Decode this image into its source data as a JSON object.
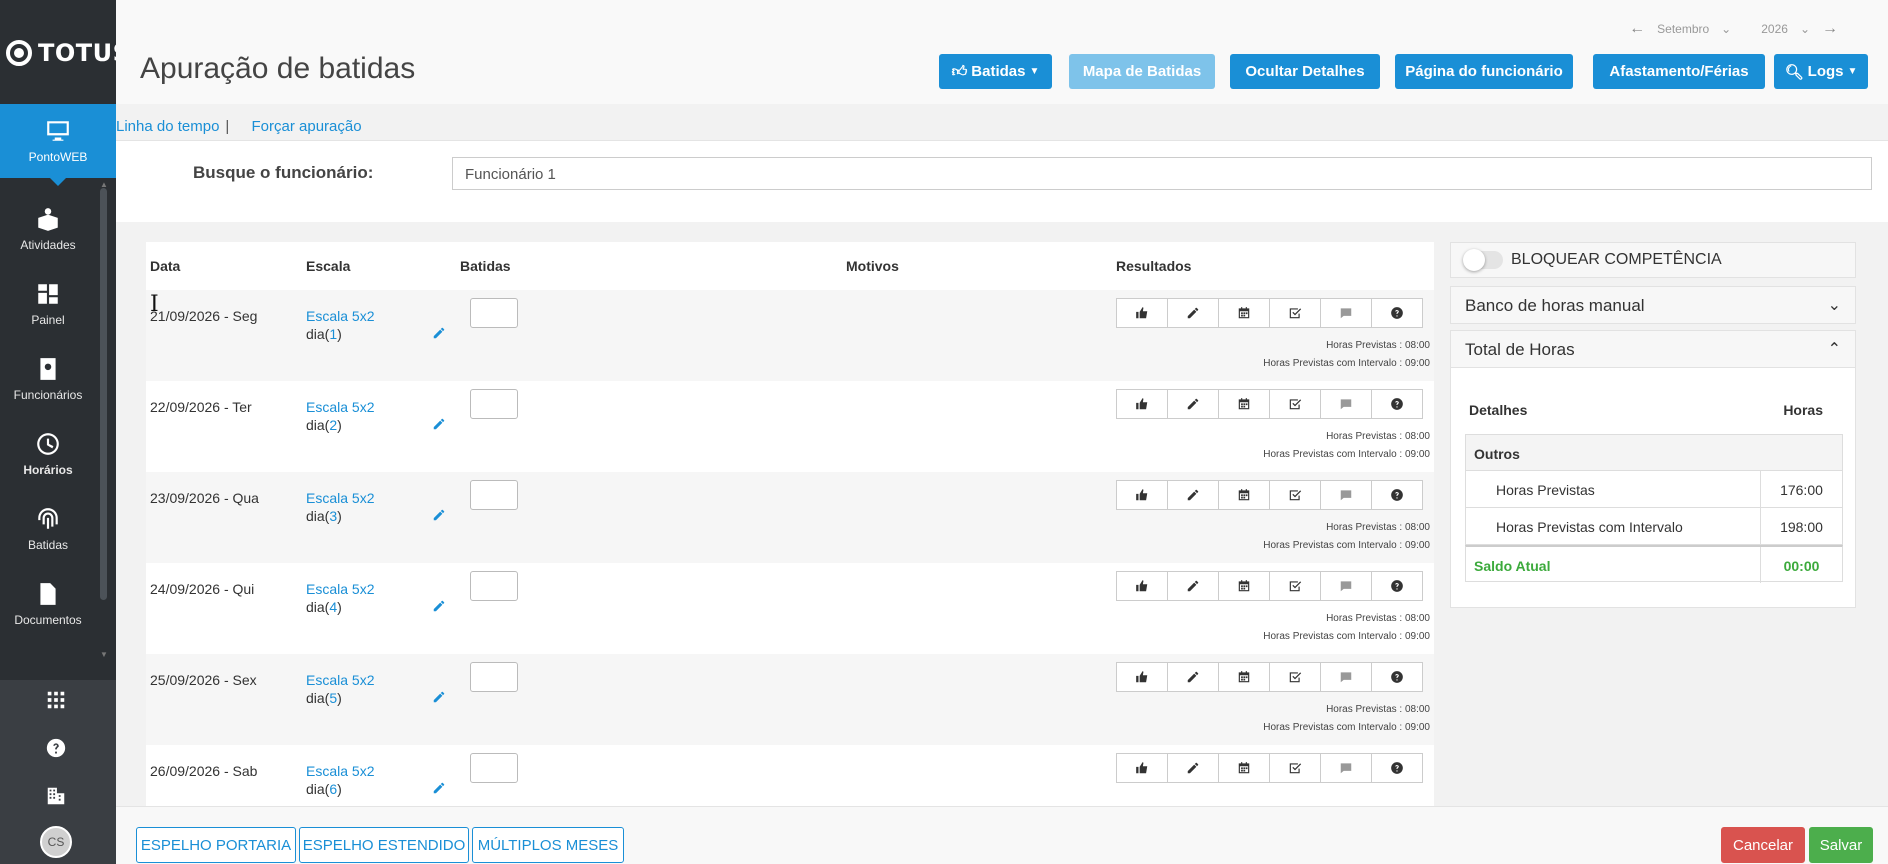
{
  "sidebar": {
    "brand": "TOTUS",
    "items": [
      {
        "label": "PontoWEB",
        "icon": "monitor-icon"
      },
      {
        "label": "Atividades",
        "icon": "activities-icon"
      },
      {
        "label": "Painel",
        "icon": "dashboard-icon"
      },
      {
        "label": "Funcionários",
        "icon": "badge-icon"
      },
      {
        "label": "Horários",
        "icon": "clock-icon"
      },
      {
        "label": "Batidas",
        "icon": "fingerprint-icon"
      },
      {
        "label": "Documentos",
        "icon": "document-icon"
      }
    ],
    "avatar": "CS"
  },
  "header": {
    "title": "Apuração de batidas",
    "month": "Setembro",
    "year": "2026",
    "buttons": {
      "batidas": "Batidas",
      "mapa": "Mapa de Batidas",
      "ocultar": "Ocultar Detalhes",
      "pagina": "Página do funcionário",
      "afastamento": "Afastamento/Férias",
      "logs": "Logs"
    }
  },
  "subnav": {
    "timeline": "Linha do tempo",
    "forcar": "Forçar apuração"
  },
  "search": {
    "label": "Busque o funcionário:",
    "value": "Funcionário 1"
  },
  "grid": {
    "headers": {
      "data": "Data",
      "escala": "Escala",
      "batidas": "Batidas",
      "motivos": "Motivos",
      "resultados": "Resultados"
    },
    "rows": [
      {
        "date": "21/09/2026 - Seg",
        "escala": "Escala 5x2",
        "dia_prefix": "dia(",
        "dia_num": "1",
        "dia_suffix": ")",
        "hp": "Horas Previstas : 08:00",
        "hpi": "Horas Previstas com Intervalo : 09:00"
      },
      {
        "date": "22/09/2026 - Ter",
        "escala": "Escala 5x2",
        "dia_prefix": "dia(",
        "dia_num": "2",
        "dia_suffix": ")",
        "hp": "Horas Previstas : 08:00",
        "hpi": "Horas Previstas com Intervalo : 09:00"
      },
      {
        "date": "23/09/2026 - Qua",
        "escala": "Escala 5x2",
        "dia_prefix": "dia(",
        "dia_num": "3",
        "dia_suffix": ")",
        "hp": "Horas Previstas : 08:00",
        "hpi": "Horas Previstas com Intervalo : 09:00"
      },
      {
        "date": "24/09/2026 - Qui",
        "escala": "Escala 5x2",
        "dia_prefix": "dia(",
        "dia_num": "4",
        "dia_suffix": ")",
        "hp": "Horas Previstas : 08:00",
        "hpi": "Horas Previstas com Intervalo : 09:00"
      },
      {
        "date": "25/09/2026 - Sex",
        "escala": "Escala 5x2",
        "dia_prefix": "dia(",
        "dia_num": "5",
        "dia_suffix": ")",
        "hp": "Horas Previstas : 08:00",
        "hpi": "Horas Previstas com Intervalo : 09:00"
      },
      {
        "date": "26/09/2026 - Sab",
        "escala": "Escala 5x2",
        "dia_prefix": "dia(",
        "dia_num": "6",
        "dia_suffix": ")",
        "hp": "",
        "hpi": ""
      }
    ],
    "action_icons": [
      "thumbs-up-icon",
      "pencil-icon",
      "calendar-icon",
      "check-square-icon",
      "comment-icon",
      "question-icon"
    ]
  },
  "side": {
    "lock_label": "BLOQUEAR COMPETÊNCIA",
    "banco": "Banco de horas manual",
    "total": "Total de Horas",
    "table": {
      "col_detalhes": "Detalhes",
      "col_horas": "Horas",
      "group": "Outros",
      "rows": [
        {
          "label": "Horas Previstas",
          "value": "176:00"
        },
        {
          "label": "Horas Previstas com Intervalo",
          "value": "198:00"
        }
      ],
      "saldo_label": "Saldo Atual",
      "saldo_value": "00:00"
    }
  },
  "footer": {
    "portaria": "ESPELHO PORTARIA",
    "estendido": "ESPELHO ESTENDIDO",
    "multiplos": "MÚLTIPLOS MESES",
    "cancelar": "Cancelar",
    "salvar": "Salvar"
  },
  "colors": {
    "accent": "#1a8fd6",
    "sidebar": "#2b2f33",
    "success": "#4cae4c",
    "danger": "#d9534f"
  }
}
